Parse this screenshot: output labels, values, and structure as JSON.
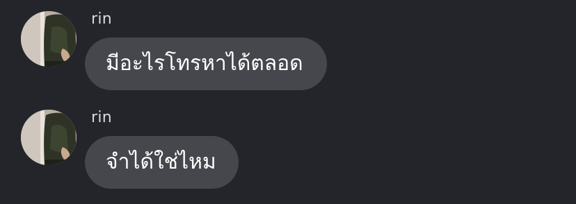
{
  "theme": {
    "background": "#24252b",
    "bubble": "#46474d",
    "name_color": "#d9dadf",
    "text_color": "#ffffff"
  },
  "messages": [
    {
      "sender": "rin",
      "avatar_icon": "user-photo-avatar",
      "text": "มีอะไรโทรหาได้ตลอด"
    },
    {
      "sender": "rin",
      "avatar_icon": "user-photo-avatar",
      "text": "จำได้ใช่ไหม"
    }
  ]
}
